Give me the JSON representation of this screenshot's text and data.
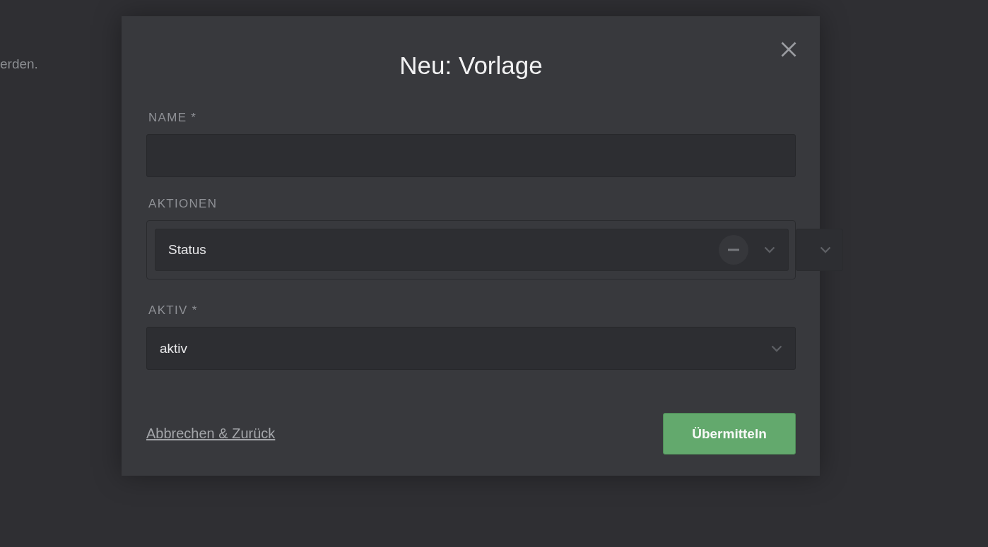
{
  "background": {
    "text": "erden."
  },
  "dialog": {
    "title": "Neu: Vorlage",
    "fields": [
      {
        "kind": "text",
        "label": "NAME *"
      },
      {
        "kind": "actions",
        "label": "AKTIONEN",
        "actions": [
          {
            "value": "Status"
          }
        ]
      },
      {
        "kind": "select",
        "label": "AKTIV *",
        "value": "aktiv"
      }
    ],
    "cancel_link": "Abbrechen & Zurück",
    "submit_button": "Übermitteln"
  }
}
